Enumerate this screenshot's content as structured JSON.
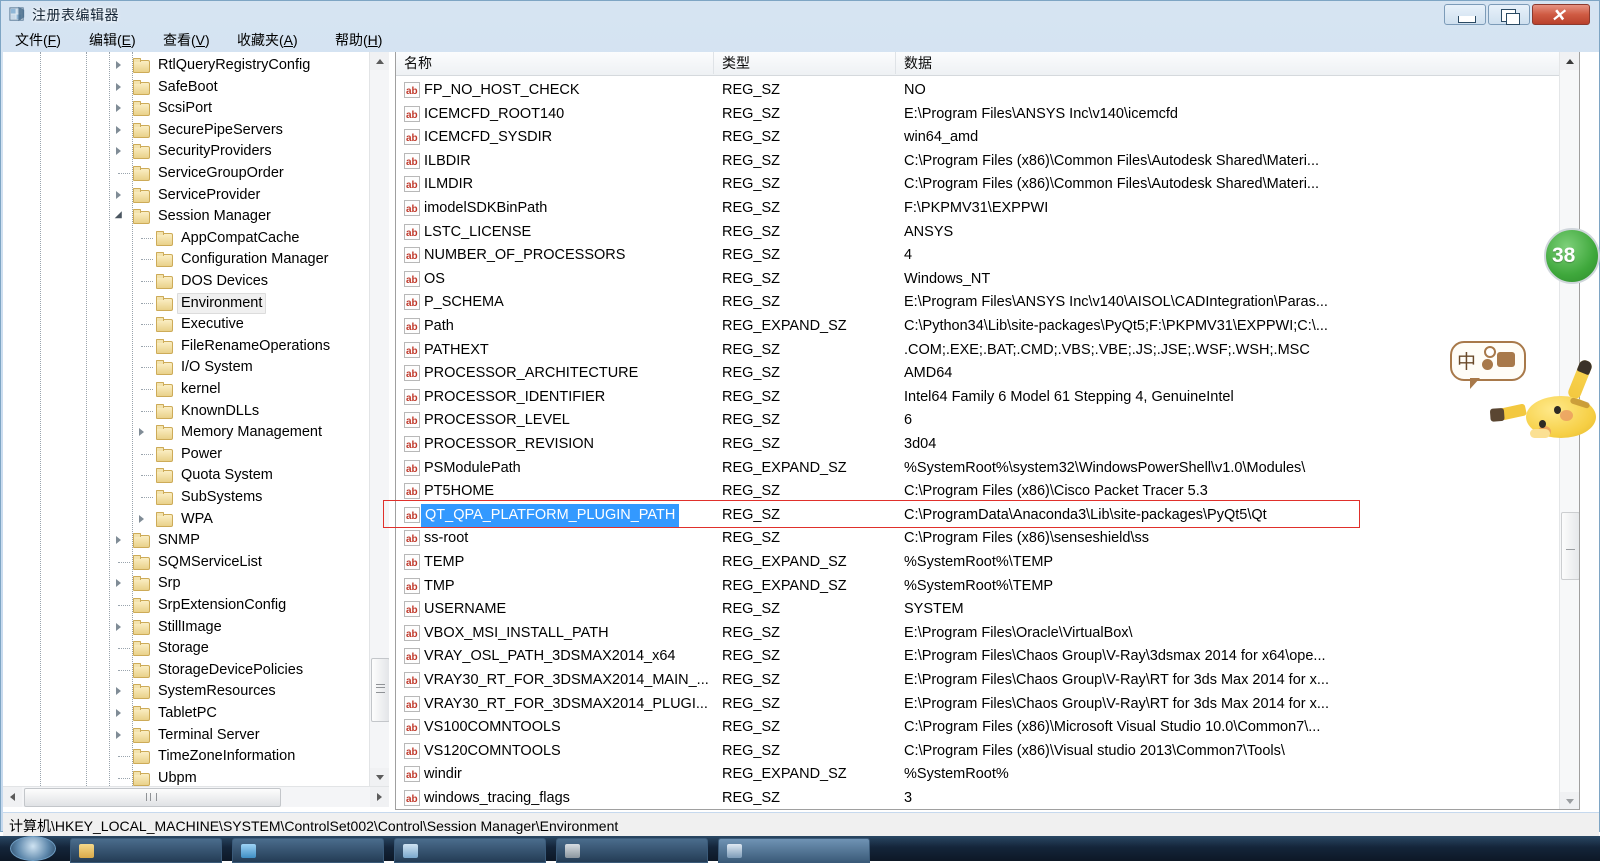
{
  "window": {
    "title": "注册表编辑器",
    "icon": "registry-editor-icon",
    "buttons": {
      "minimize": "最小化",
      "maximize": "最大化",
      "close": "关闭"
    }
  },
  "menubar": {
    "items": [
      {
        "label": "文件(F)",
        "pre": "文件(",
        "key": "F",
        "post": ")"
      },
      {
        "label": "编辑(E)",
        "pre": "编辑(",
        "key": "E",
        "post": ")"
      },
      {
        "label": "查看(V)",
        "pre": "查看(",
        "key": "V",
        "post": ")"
      },
      {
        "label": "收藏夹(A)",
        "pre": "收藏夹(",
        "key": "A",
        "post": ")"
      },
      {
        "label": "帮助(H)",
        "pre": "帮助(",
        "key": "H",
        "post": ")"
      }
    ]
  },
  "tree": {
    "nodes": [
      {
        "label": "RtlQueryRegistryConfig",
        "indent": 1,
        "expander": "collapsed",
        "selected": false
      },
      {
        "label": "SafeBoot",
        "indent": 1,
        "expander": "collapsed",
        "selected": false
      },
      {
        "label": "ScsiPort",
        "indent": 1,
        "expander": "collapsed",
        "selected": false
      },
      {
        "label": "SecurePipeServers",
        "indent": 1,
        "expander": "collapsed",
        "selected": false
      },
      {
        "label": "SecurityProviders",
        "indent": 1,
        "expander": "collapsed",
        "selected": false
      },
      {
        "label": "ServiceGroupOrder",
        "indent": 1,
        "expander": "none",
        "selected": false
      },
      {
        "label": "ServiceProvider",
        "indent": 1,
        "expander": "collapsed",
        "selected": false
      },
      {
        "label": "Session Manager",
        "indent": 1,
        "expander": "expanded",
        "selected": false
      },
      {
        "label": "AppCompatCache",
        "indent": 2,
        "expander": "none",
        "selected": false
      },
      {
        "label": "Configuration Manager",
        "indent": 2,
        "expander": "none",
        "selected": false
      },
      {
        "label": "DOS Devices",
        "indent": 2,
        "expander": "none",
        "selected": false
      },
      {
        "label": "Environment",
        "indent": 2,
        "expander": "none",
        "selected": true
      },
      {
        "label": "Executive",
        "indent": 2,
        "expander": "none",
        "selected": false
      },
      {
        "label": "FileRenameOperations",
        "indent": 2,
        "expander": "none",
        "selected": false
      },
      {
        "label": "I/O System",
        "indent": 2,
        "expander": "none",
        "selected": false
      },
      {
        "label": "kernel",
        "indent": 2,
        "expander": "none",
        "selected": false
      },
      {
        "label": "KnownDLLs",
        "indent": 2,
        "expander": "none",
        "selected": false
      },
      {
        "label": "Memory Management",
        "indent": 2,
        "expander": "collapsed",
        "selected": false
      },
      {
        "label": "Power",
        "indent": 2,
        "expander": "none",
        "selected": false
      },
      {
        "label": "Quota System",
        "indent": 2,
        "expander": "none",
        "selected": false
      },
      {
        "label": "SubSystems",
        "indent": 2,
        "expander": "none",
        "selected": false
      },
      {
        "label": "WPA",
        "indent": 2,
        "expander": "collapsed",
        "selected": false
      },
      {
        "label": "SNMP",
        "indent": 1,
        "expander": "collapsed",
        "selected": false
      },
      {
        "label": "SQMServiceList",
        "indent": 1,
        "expander": "none",
        "selected": false
      },
      {
        "label": "Srp",
        "indent": 1,
        "expander": "collapsed",
        "selected": false
      },
      {
        "label": "SrpExtensionConfig",
        "indent": 1,
        "expander": "none",
        "selected": false
      },
      {
        "label": "StillImage",
        "indent": 1,
        "expander": "collapsed",
        "selected": false
      },
      {
        "label": "Storage",
        "indent": 1,
        "expander": "none",
        "selected": false
      },
      {
        "label": "StorageDevicePolicies",
        "indent": 1,
        "expander": "none",
        "selected": false
      },
      {
        "label": "SystemResources",
        "indent": 1,
        "expander": "collapsed",
        "selected": false
      },
      {
        "label": "TabletPC",
        "indent": 1,
        "expander": "collapsed",
        "selected": false
      },
      {
        "label": "Terminal Server",
        "indent": 1,
        "expander": "collapsed",
        "selected": false
      },
      {
        "label": "TimeZoneInformation",
        "indent": 1,
        "expander": "none",
        "selected": false
      },
      {
        "label": "Ubpm",
        "indent": 1,
        "expander": "none",
        "selected": false
      }
    ]
  },
  "list": {
    "headers": {
      "name": "名称",
      "type": "类型",
      "data": "数据"
    },
    "rows": [
      {
        "name": "FP_NO_HOST_CHECK",
        "type": "REG_SZ",
        "data": "NO",
        "selected": false
      },
      {
        "name": "ICEMCFD_ROOT140",
        "type": "REG_SZ",
        "data": "E:\\Program Files\\ANSYS Inc\\v140\\icemcfd",
        "selected": false
      },
      {
        "name": "ICEMCFD_SYSDIR",
        "type": "REG_SZ",
        "data": "win64_amd",
        "selected": false
      },
      {
        "name": "ILBDIR",
        "type": "REG_SZ",
        "data": "C:\\Program Files (x86)\\Common Files\\Autodesk Shared\\Materi...",
        "selected": false
      },
      {
        "name": "ILMDIR",
        "type": "REG_SZ",
        "data": "C:\\Program Files (x86)\\Common Files\\Autodesk Shared\\Materi...",
        "selected": false
      },
      {
        "name": "imodelSDKBinPath",
        "type": "REG_SZ",
        "data": "F:\\PKPMV31\\EXPPWI",
        "selected": false
      },
      {
        "name": "LSTC_LICENSE",
        "type": "REG_SZ",
        "data": "ANSYS",
        "selected": false
      },
      {
        "name": "NUMBER_OF_PROCESSORS",
        "type": "REG_SZ",
        "data": "4",
        "selected": false
      },
      {
        "name": "OS",
        "type": "REG_SZ",
        "data": "Windows_NT",
        "selected": false
      },
      {
        "name": "P_SCHEMA",
        "type": "REG_SZ",
        "data": "E:\\Program Files\\ANSYS Inc\\v140\\AISOL\\CADIntegration\\Paras...",
        "selected": false
      },
      {
        "name": "Path",
        "type": "REG_EXPAND_SZ",
        "data": "C:\\Python34\\Lib\\site-packages\\PyQt5;F:\\PKPMV31\\EXPPWI;C:\\...",
        "selected": false
      },
      {
        "name": "PATHEXT",
        "type": "REG_SZ",
        "data": ".COM;.EXE;.BAT;.CMD;.VBS;.VBE;.JS;.JSE;.WSF;.WSH;.MSC",
        "selected": false
      },
      {
        "name": "PROCESSOR_ARCHITECTURE",
        "type": "REG_SZ",
        "data": "AMD64",
        "selected": false
      },
      {
        "name": "PROCESSOR_IDENTIFIER",
        "type": "REG_SZ",
        "data": "Intel64 Family 6 Model 61 Stepping 4, GenuineIntel",
        "selected": false
      },
      {
        "name": "PROCESSOR_LEVEL",
        "type": "REG_SZ",
        "data": "6",
        "selected": false
      },
      {
        "name": "PROCESSOR_REVISION",
        "type": "REG_SZ",
        "data": "3d04",
        "selected": false
      },
      {
        "name": "PSModulePath",
        "type": "REG_EXPAND_SZ",
        "data": "%SystemRoot%\\system32\\WindowsPowerShell\\v1.0\\Modules\\",
        "selected": false
      },
      {
        "name": "PT5HOME",
        "type": "REG_SZ",
        "data": "C:\\Program Files (x86)\\Cisco Packet Tracer 5.3",
        "selected": false
      },
      {
        "name": "QT_QPA_PLATFORM_PLUGIN_PATH",
        "type": "REG_SZ",
        "data": "C:\\ProgramData\\Anaconda3\\Lib\\site-packages\\PyQt5\\Qt",
        "selected": true
      },
      {
        "name": "ss-root",
        "type": "REG_SZ",
        "data": "C:\\Program Files (x86)\\senseshield\\ss",
        "selected": false
      },
      {
        "name": "TEMP",
        "type": "REG_EXPAND_SZ",
        "data": "%SystemRoot%\\TEMP",
        "selected": false
      },
      {
        "name": "TMP",
        "type": "REG_EXPAND_SZ",
        "data": "%SystemRoot%\\TEMP",
        "selected": false
      },
      {
        "name": "USERNAME",
        "type": "REG_SZ",
        "data": "SYSTEM",
        "selected": false
      },
      {
        "name": "VBOX_MSI_INSTALL_PATH",
        "type": "REG_SZ",
        "data": "E:\\Program Files\\Oracle\\VirtualBox\\",
        "selected": false
      },
      {
        "name": "VRAY_OSL_PATH_3DSMAX2014_x64",
        "type": "REG_SZ",
        "data": "E:\\Program Files\\Chaos Group\\V-Ray\\3dsmax 2014 for x64\\ope...",
        "selected": false
      },
      {
        "name": "VRAY30_RT_FOR_3DSMAX2014_MAIN_...",
        "type": "REG_SZ",
        "data": "E:\\Program Files\\Chaos Group\\V-Ray\\RT for 3ds Max 2014 for x...",
        "selected": false
      },
      {
        "name": "VRAY30_RT_FOR_3DSMAX2014_PLUGI...",
        "type": "REG_SZ",
        "data": "E:\\Program Files\\Chaos Group\\V-Ray\\RT for 3ds Max 2014 for x...",
        "selected": false
      },
      {
        "name": "VS100COMNTOOLS",
        "type": "REG_SZ",
        "data": "C:\\Program Files (x86)\\Microsoft Visual Studio 10.0\\Common7\\...",
        "selected": false
      },
      {
        "name": "VS120COMNTOOLS",
        "type": "REG_SZ",
        "data": "C:\\Program Files (x86)\\Visual studio 2013\\Common7\\Tools\\",
        "selected": false
      },
      {
        "name": "windir",
        "type": "REG_EXPAND_SZ",
        "data": "%SystemRoot%",
        "selected": false
      },
      {
        "name": "windows_tracing_flags",
        "type": "REG_SZ",
        "data": "3",
        "selected": false
      }
    ]
  },
  "statusbar": {
    "path": "计算机\\HKEY_LOCAL_MACHINE\\SYSTEM\\ControlSet002\\Control\\Session Manager\\Environment"
  },
  "overlays": {
    "badge": {
      "value": "38",
      "color": "#3fa83c"
    },
    "ime": {
      "mode": "中",
      "character_set": "chinese"
    },
    "annotation": {
      "color": "#e0302b",
      "target": "QT_QPA_PLATFORM_PLUGIN_PATH"
    }
  }
}
